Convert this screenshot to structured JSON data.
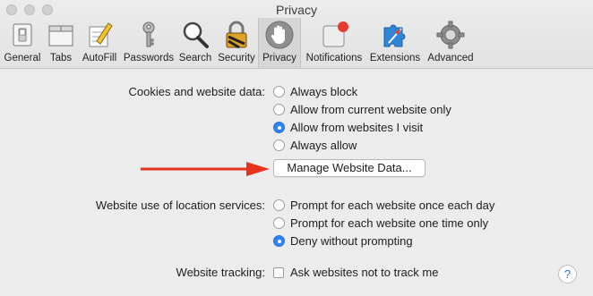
{
  "window": {
    "title": "Privacy"
  },
  "toolbar": {
    "items": [
      {
        "label": "General",
        "icon": "general-switch-icon"
      },
      {
        "label": "Tabs",
        "icon": "tabs-icon"
      },
      {
        "label": "AutoFill",
        "icon": "autofill-pencil-icon"
      },
      {
        "label": "Passwords",
        "icon": "key-icon"
      },
      {
        "label": "Search",
        "icon": "magnifier-icon"
      },
      {
        "label": "Security",
        "icon": "padlock-icon"
      },
      {
        "label": "Privacy",
        "icon": "hand-icon",
        "active": true
      },
      {
        "label": "Notifications",
        "icon": "notification-badge-icon"
      },
      {
        "label": "Extensions",
        "icon": "puzzle-compass-icon"
      },
      {
        "label": "Advanced",
        "icon": "gear-icon"
      }
    ]
  },
  "cookies": {
    "label": "Cookies and website data:",
    "options": [
      "Always block",
      "Allow from current website only",
      "Allow from websites I visit",
      "Always allow"
    ],
    "selected": "Allow from websites I visit",
    "manage_button": "Manage Website Data..."
  },
  "location": {
    "label": "Website use of location services:",
    "options": [
      "Prompt for each website once each day",
      "Prompt for each website one time only",
      "Deny without prompting"
    ],
    "selected": "Deny without prompting"
  },
  "tracking": {
    "label": "Website tracking:",
    "checkbox_label": "Ask websites not to track me",
    "checked": false
  },
  "help": {
    "label": "?"
  },
  "colors": {
    "accent": "#2e83f6",
    "arrow": "#e8331c",
    "notification_badge": "#e63b2e"
  }
}
